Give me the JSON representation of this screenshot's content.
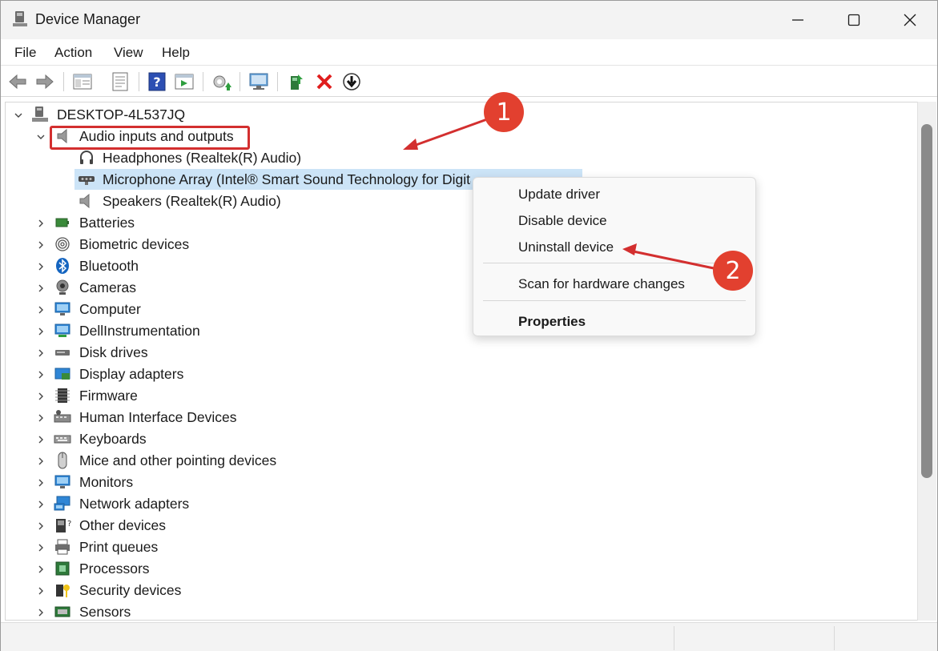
{
  "window": {
    "title": "Device Manager",
    "minimize_icon": "minimize-icon",
    "maximize_icon": "maximize-icon",
    "close_icon": "close-icon"
  },
  "menubar": {
    "items": [
      "File",
      "Action",
      "View",
      "Help"
    ]
  },
  "toolbar": {
    "buttons": [
      "back-icon",
      "forward-icon",
      "console-tree-icon",
      "properties-icon",
      "help-icon",
      "action-pane-icon",
      "update-driver-icon",
      "scan-hardware-icon",
      "enable-device-icon",
      "uninstall-icon",
      "disable-device-icon"
    ]
  },
  "tree": {
    "root": "DESKTOP-4L537JQ",
    "expanded_category": "Audio inputs and outputs",
    "audio_children": [
      "Headphones (Realtek(R) Audio)",
      "Microphone Array (Intel® Smart Sound Technology for Digital Microphones)",
      "Speakers (Realtek(R) Audio)"
    ],
    "categories": [
      "Batteries",
      "Biometric devices",
      "Bluetooth",
      "Cameras",
      "Computer",
      "DellInstrumentation",
      "Disk drives",
      "Display adapters",
      "Firmware",
      "Human Interface Devices",
      "Keyboards",
      "Mice and other pointing devices",
      "Monitors",
      "Network adapters",
      "Other devices",
      "Print queues",
      "Processors",
      "Security devices",
      "Sensors"
    ]
  },
  "context_menu": {
    "update_driver": "Update driver",
    "disable_device": "Disable device",
    "uninstall_device": "Uninstall device",
    "scan_hardware": "Scan for hardware changes",
    "properties": "Properties"
  },
  "annotations": {
    "callout_1": "1",
    "callout_2": "2",
    "accent_color": "#d32f2f"
  },
  "colors": {
    "selection": "#cce4f7",
    "titlebar": "#f3f3f3"
  }
}
